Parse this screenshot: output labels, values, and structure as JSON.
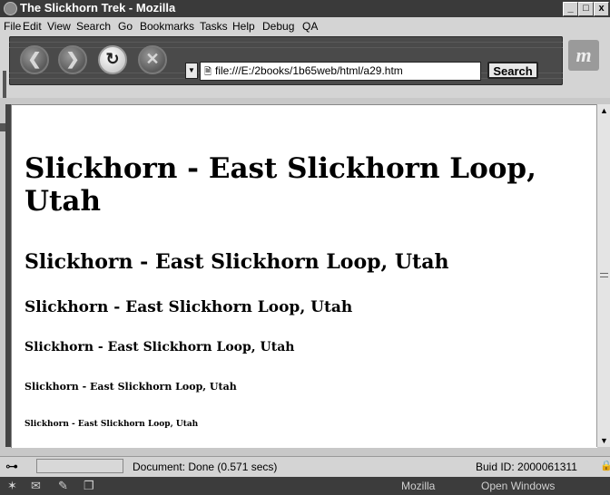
{
  "window": {
    "title": "The Slickhorn Trek - Mozilla",
    "controls": [
      "_",
      "□",
      "x"
    ]
  },
  "menu": [
    "File",
    "Edit",
    "View",
    "Search",
    "Go",
    "Bookmarks",
    "Tasks",
    "Help",
    "Debug",
    "QA"
  ],
  "toolbar": {
    "url": "file:///E:/2books/1b65web/html/a29.htm",
    "search_label": "Search",
    "logo": "m"
  },
  "page": {
    "headings": [
      "Slickhorn - East Slickhorn Loop, Utah",
      "Slickhorn - East Slickhorn Loop, Utah",
      "Slickhorn - East Slickhorn Loop, Utah",
      "Slickhorn - East Slickhorn Loop, Utah",
      "Slickhorn - East Slickhorn Loop, Utah",
      "Slickhorn - East Slickhorn Loop, Utah"
    ]
  },
  "statusbar": {
    "status": "Document: Done (0.571 secs)",
    "build": "Buid ID: 2000061311"
  },
  "taskbar": {
    "app_name": "Mozilla",
    "windows_label": "Open Windows"
  }
}
